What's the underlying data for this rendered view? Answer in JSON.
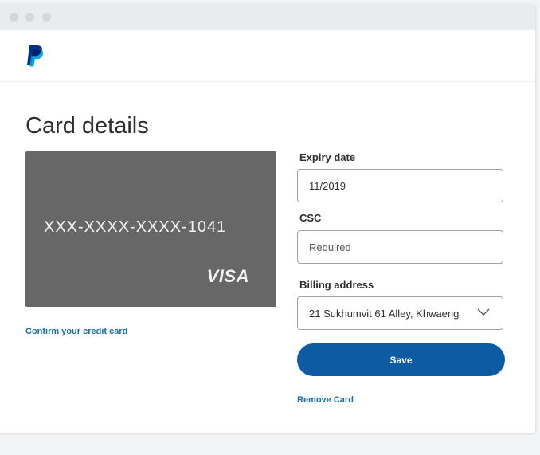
{
  "colors": {
    "brand_dark": "#003087",
    "brand_light": "#009cde",
    "card_bg": "#676767",
    "primary_button": "#0d5ba3",
    "link": "#1a6fa6"
  },
  "header": {
    "logo_icon": "paypal-logo-icon"
  },
  "page": {
    "title": "Card details"
  },
  "card": {
    "number": "XXX-XXXX-XXXX-1041",
    "brand": "VISA",
    "confirm_link": "Confirm your credit card"
  },
  "form": {
    "expiry_label": "Expiry date",
    "expiry_value": "11/2019",
    "csc_label": "CSC",
    "csc_placeholder": "Required",
    "billing_label": "Billing address",
    "billing_value": "21 Sukhumvit 61 Alley, Khwaeng",
    "billing_icon": "chevron-down-icon",
    "save_label": "Save",
    "remove_label": "Remove Card"
  }
}
